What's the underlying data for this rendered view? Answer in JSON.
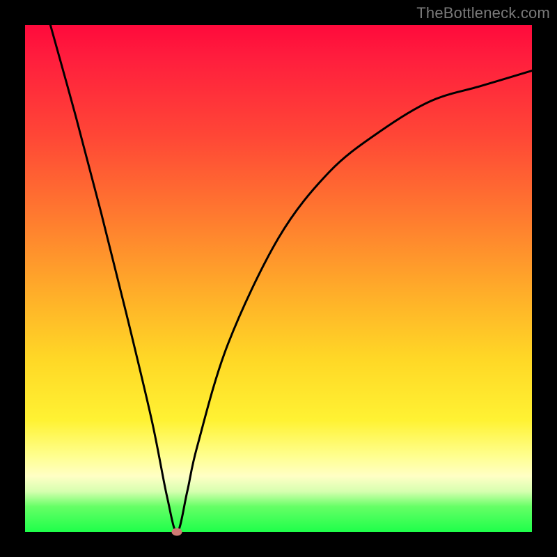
{
  "watermark": "TheBottleneck.com",
  "chart_data": {
    "type": "line",
    "title": "",
    "xlabel": "",
    "ylabel": "",
    "xlim": [
      0,
      100
    ],
    "ylim": [
      0,
      100
    ],
    "grid": false,
    "series": [
      {
        "name": "bottleneck-curve",
        "x": [
          5,
          10,
          15,
          20,
          25,
          28,
          30,
          32,
          34,
          40,
          50,
          60,
          70,
          80,
          90,
          100
        ],
        "y": [
          100,
          82,
          63,
          43,
          22,
          7,
          0,
          8,
          17,
          37,
          58,
          71,
          79,
          85,
          88,
          91
        ]
      }
    ],
    "marker": {
      "x": 30,
      "y": 0,
      "color": "#cf7a74"
    },
    "gradient_stops": [
      {
        "pos": 0.0,
        "color": "#ff0a3c"
      },
      {
        "pos": 0.22,
        "color": "#ff4736"
      },
      {
        "pos": 0.53,
        "color": "#ffae29"
      },
      {
        "pos": 0.78,
        "color": "#fff233"
      },
      {
        "pos": 0.92,
        "color": "#d7ffb0"
      },
      {
        "pos": 1.0,
        "color": "#1eff4a"
      }
    ]
  }
}
